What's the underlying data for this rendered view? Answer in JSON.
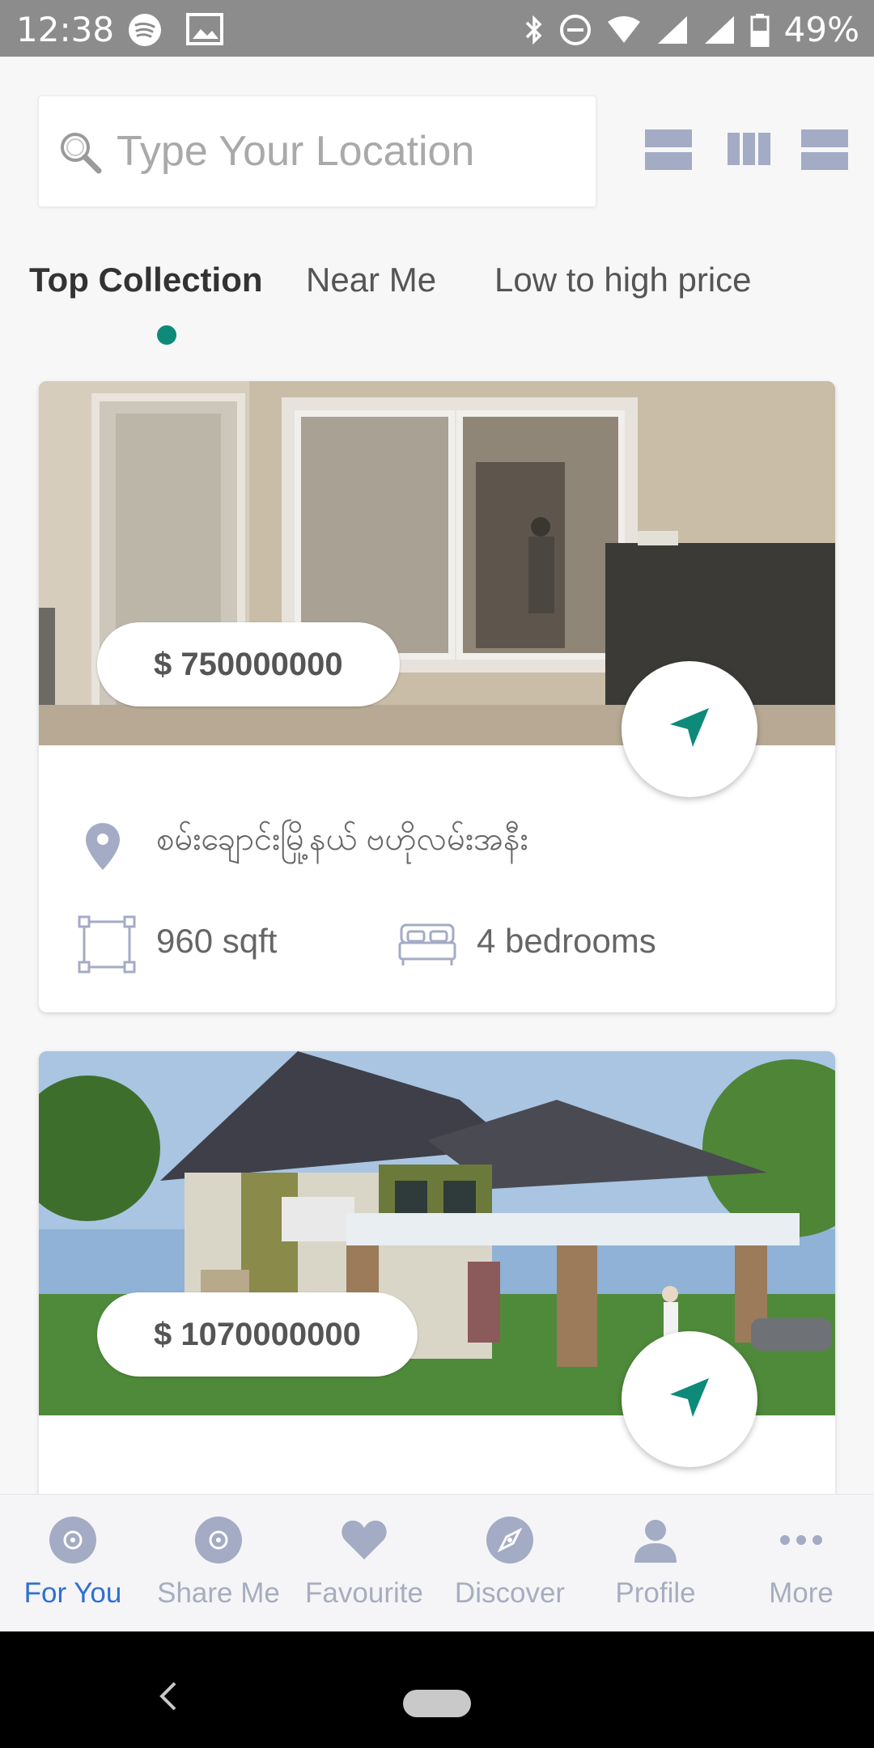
{
  "status_bar": {
    "time": "12:38",
    "battery": "49%",
    "left_icons": [
      "spotify-icon",
      "photo-icon"
    ],
    "right_icons": [
      "bluetooth-icon",
      "dnd-icon",
      "wifi-icon",
      "signal-icon",
      "signal-icon",
      "battery-icon"
    ]
  },
  "search": {
    "placeholder": "Type Your Location",
    "icon": "search-icon"
  },
  "layout_buttons": [
    "layout-list-icon",
    "layout-grid-icon",
    "layout-wide-icon"
  ],
  "tabs": [
    {
      "label": "Top Collection",
      "active": true
    },
    {
      "label": "Near Me",
      "active": false
    },
    {
      "label": "Low to high price",
      "active": false
    }
  ],
  "listings": [
    {
      "price": "$ 750000000",
      "location": "စမ်းချောင်းမြို့နယ် ဗဟိုလမ်းအနီး",
      "area": "960 sqft",
      "bedrooms": "4 bedrooms",
      "image": "apartment-interior-photo"
    },
    {
      "price": "$ 1070000000",
      "location": "",
      "image": "house-exterior-photo"
    }
  ],
  "bottom_nav": [
    {
      "label": "For You",
      "icon": "disc-icon",
      "active": true
    },
    {
      "label": "Share Me",
      "icon": "disc-icon",
      "active": false
    },
    {
      "label": "Favourite",
      "icon": "heart-icon",
      "active": false
    },
    {
      "label": "Discover",
      "icon": "compass-icon",
      "active": false
    },
    {
      "label": "Profile",
      "icon": "person-icon",
      "active": false
    },
    {
      "label": "More",
      "icon": "more-icon",
      "active": false
    }
  ],
  "colors": {
    "accent": "#0d8a7a",
    "nav_active": "#2f6fd1",
    "nav_inactive": "#a7adbf",
    "icon_slate": "#a4abc5"
  }
}
